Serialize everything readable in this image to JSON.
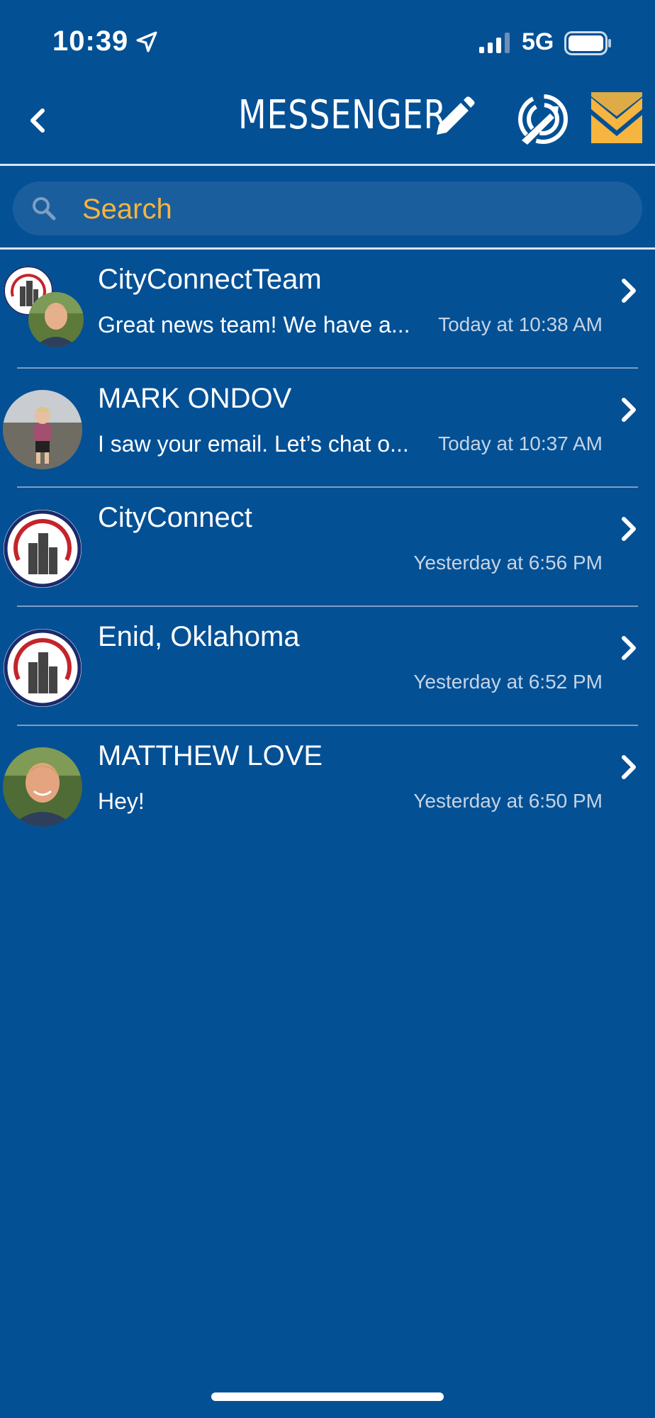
{
  "status_bar": {
    "time": "10:39",
    "network": "5G"
  },
  "header": {
    "title": "MESSENGER"
  },
  "search": {
    "placeholder": "Search"
  },
  "conversations": [
    {
      "name": "CityConnectTeam",
      "preview": "Great news team! We have a...",
      "timestamp": "Today at 10:38 AM"
    },
    {
      "name": "MARK ONDOV",
      "preview": "I saw your email. Let’s chat o...",
      "timestamp": "Today at 10:37 AM"
    },
    {
      "name": "CityConnect",
      "preview": "",
      "timestamp": "Yesterday at 6:56 PM"
    },
    {
      "name": "Enid, Oklahoma",
      "preview": "",
      "timestamp": "Yesterday at 6:52 PM"
    },
    {
      "name": "MATTHEW LOVE",
      "preview": "Hey!",
      "timestamp": "Yesterday at 6:50 PM"
    }
  ],
  "colors": {
    "background": "#035095",
    "search_bg": "#1b5e9e",
    "accent": "#f6b53e",
    "timestamp": "#c6d4e5"
  },
  "icons": [
    "location-arrow-icon",
    "signal-icon",
    "battery-icon",
    "back-chevron-icon",
    "pencil-icon",
    "broadcast-icon",
    "mail-icon",
    "search-icon",
    "chevron-right-icon"
  ]
}
